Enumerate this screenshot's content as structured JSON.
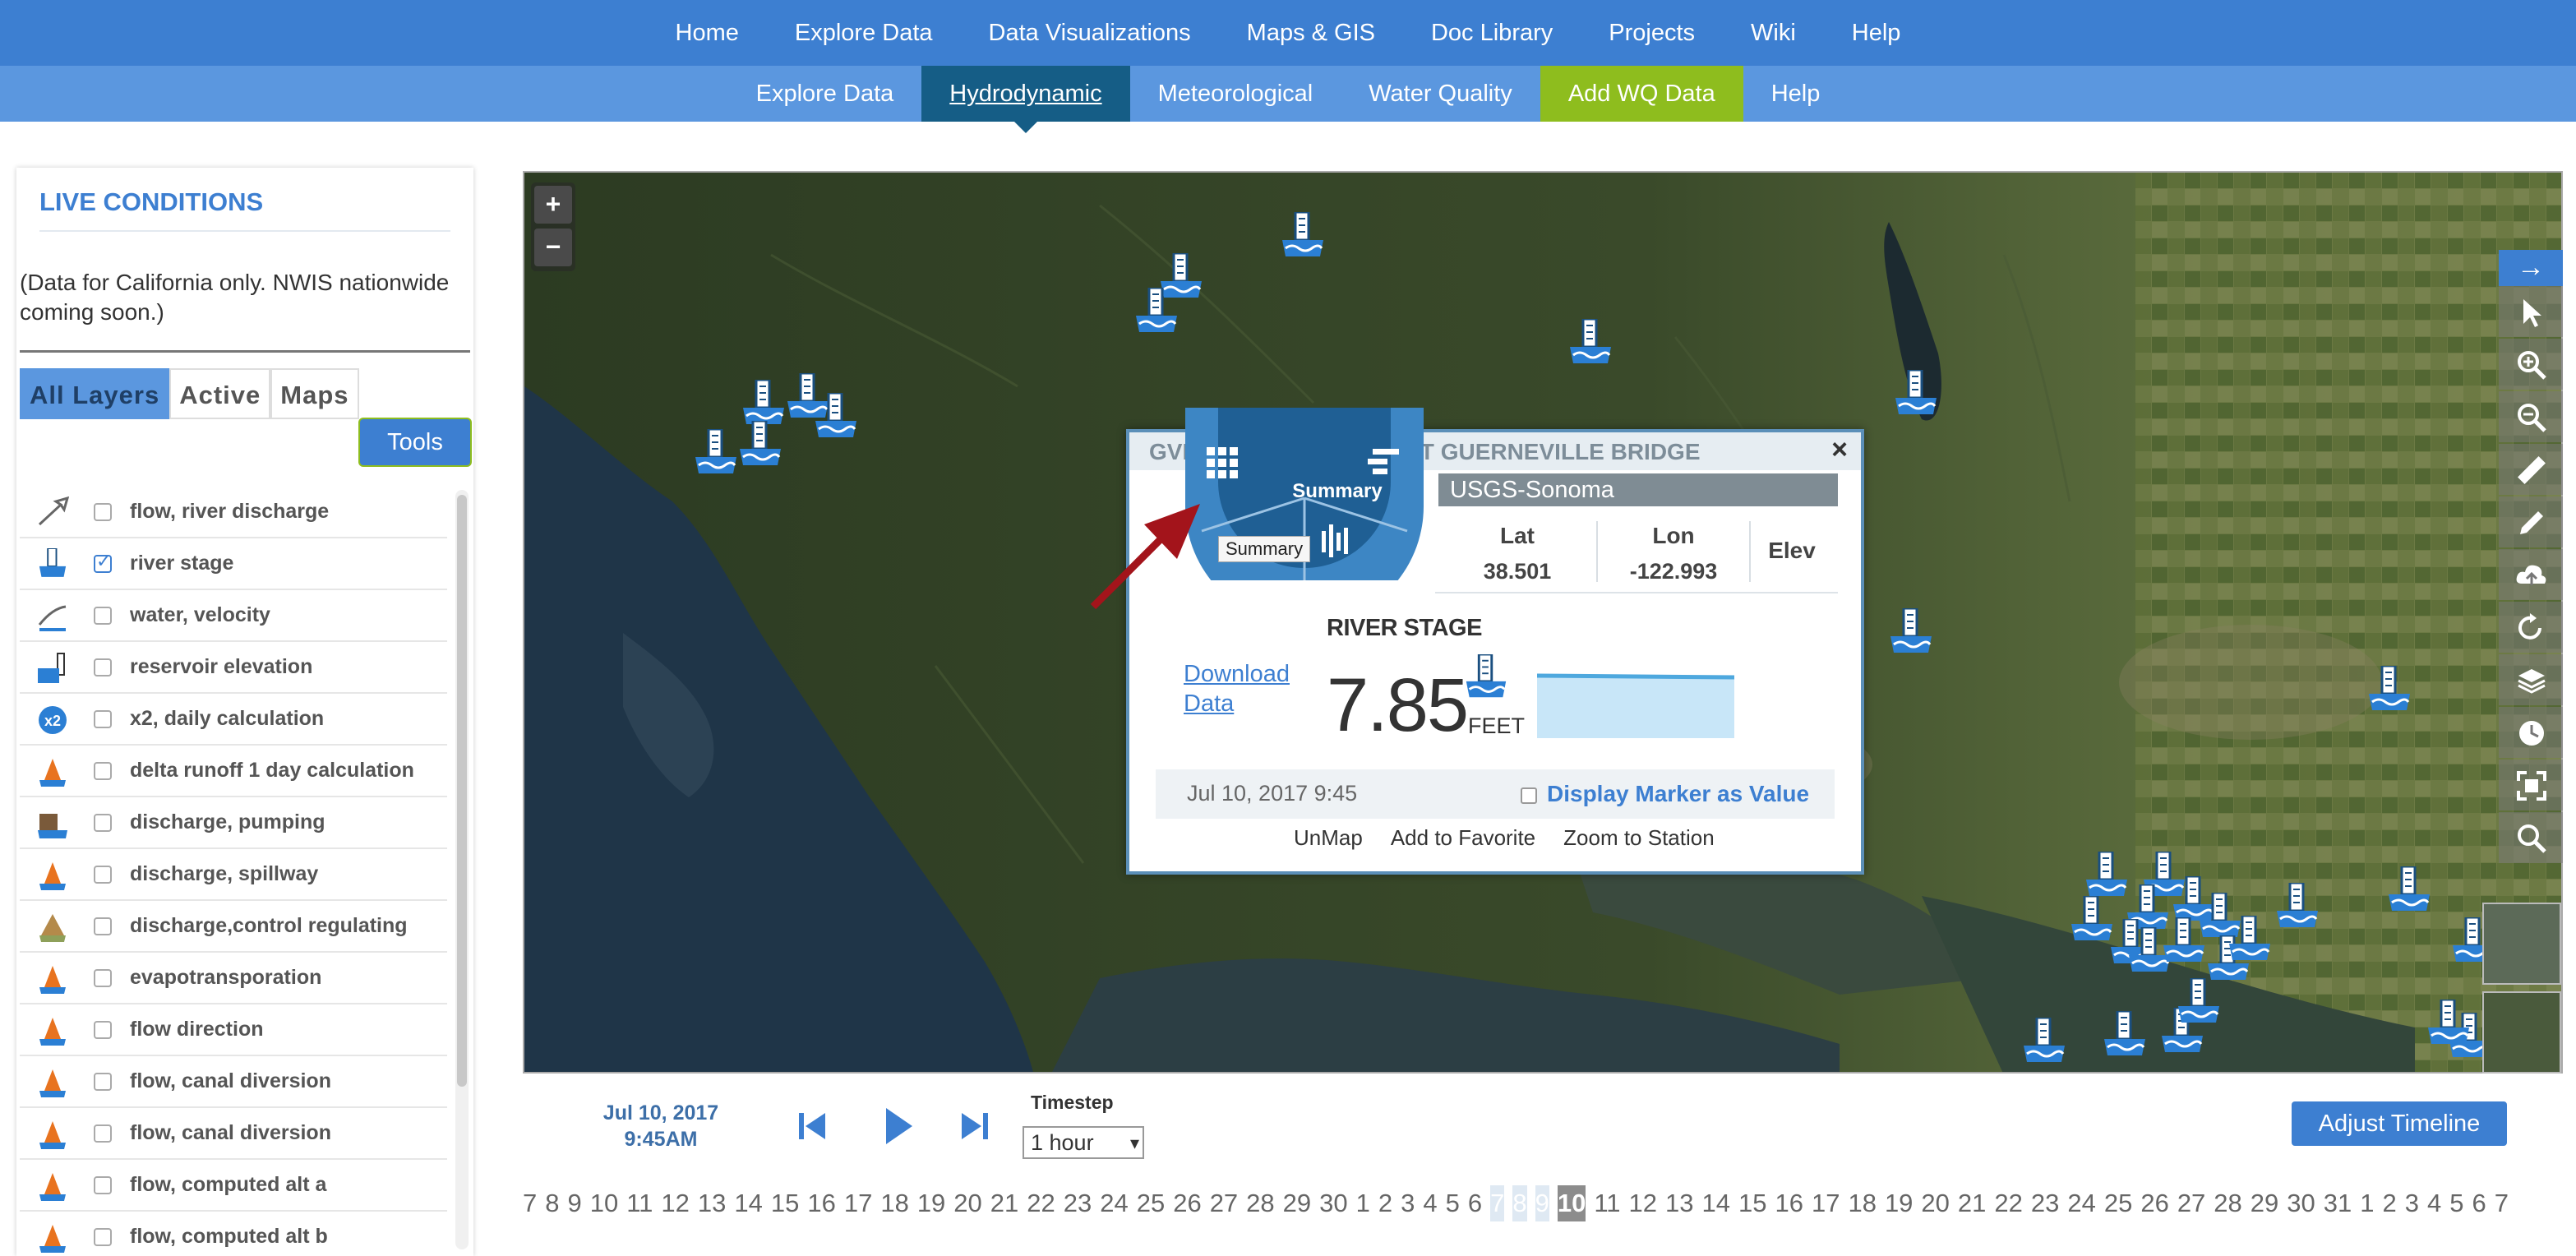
{
  "topnav": [
    "Home",
    "Explore Data",
    "Data Visualizations",
    "Maps & GIS",
    "Doc Library",
    "Projects",
    "Wiki",
    "Help"
  ],
  "subnav": [
    {
      "label": "Explore Data",
      "style": "normal"
    },
    {
      "label": "Hydrodynamic",
      "style": "active"
    },
    {
      "label": "Meteorological",
      "style": "normal"
    },
    {
      "label": "Water Quality",
      "style": "normal"
    },
    {
      "label": "Add WQ Data",
      "style": "green"
    },
    {
      "label": "Help",
      "style": "normal"
    }
  ],
  "panel": {
    "title": "LIVE CONDITIONS",
    "note": "(Data for California only. NWIS nationwide coming soon.)",
    "tabs": [
      "All Layers",
      "Active",
      "Maps"
    ],
    "tools_label": "Tools",
    "layers": [
      {
        "label": "flow, river discharge",
        "checked": false,
        "icon": "arrow-icon"
      },
      {
        "label": "river stage",
        "checked": true,
        "icon": "gauge-icon"
      },
      {
        "label": "water, velocity",
        "checked": false,
        "icon": "velocity-icon"
      },
      {
        "label": "reservoir elevation",
        "checked": false,
        "icon": "reservoir-icon"
      },
      {
        "label": "x2, daily calculation",
        "checked": false,
        "icon": "x2-icon"
      },
      {
        "label": "delta runoff 1 day calculation",
        "checked": false,
        "icon": "cone-icon"
      },
      {
        "label": "discharge, pumping",
        "checked": false,
        "icon": "pump-icon"
      },
      {
        "label": "discharge, spillway",
        "checked": false,
        "icon": "cone-icon"
      },
      {
        "label": "discharge,control regulating",
        "checked": false,
        "icon": "control-icon"
      },
      {
        "label": "evapotransporation",
        "checked": false,
        "icon": "cone-icon"
      },
      {
        "label": "flow direction",
        "checked": false,
        "icon": "cone-icon"
      },
      {
        "label": "flow, canal diversion",
        "checked": false,
        "icon": "cone-icon"
      },
      {
        "label": "flow, canal diversion",
        "checked": false,
        "icon": "cone-icon"
      },
      {
        "label": "flow, computed alt a",
        "checked": false,
        "icon": "cone-icon"
      },
      {
        "label": "flow, computed alt b",
        "checked": false,
        "icon": "cone-icon"
      }
    ]
  },
  "map": {
    "zoom_in": "+",
    "zoom_out": "−"
  },
  "popup": {
    "title": "GVB - RUSSIAN RIVER AT GUERNEVILLE BRIDGE",
    "close": "×",
    "owner": "USGS-Sonoma",
    "wheel_label": "Summary",
    "tooltip": "Summary",
    "lat_label": "Lat",
    "lat": "38.501",
    "lon_label": "Lon",
    "lon": "-122.993",
    "elev_label": "Elev",
    "measure_label": "RIVER STAGE",
    "download": "Download Data",
    "value": "7.85",
    "unit": "FEET",
    "timestamp": "Jul 10, 2017 9:45",
    "display_marker": "Display Marker as Value",
    "actions": [
      "UnMap",
      "Add to Favorite",
      "Zoom to Station"
    ]
  },
  "timeline": {
    "date_line1": "Jul 10, 2017",
    "date_line2": "9:45AM",
    "timestep_label": "Timestep",
    "timestep_value": "1 hour",
    "adjust_label": "Adjust Timeline",
    "days": [
      "7",
      "8",
      "9",
      "10",
      "11",
      "12",
      "13",
      "14",
      "15",
      "16",
      "17",
      "18",
      "19",
      "20",
      "21",
      "22",
      "23",
      "24",
      "25",
      "26",
      "27",
      "28",
      "29",
      "30",
      "1",
      "2",
      "3",
      "4",
      "5",
      "6",
      "7",
      "8",
      "9",
      "10",
      "11",
      "12",
      "13",
      "14",
      "15",
      "16",
      "17",
      "18",
      "19",
      "20",
      "21",
      "22",
      "23",
      "24",
      "25",
      "26",
      "27",
      "28",
      "29",
      "30",
      "31",
      "1",
      "2",
      "3",
      "4",
      "5",
      "6",
      "7"
    ],
    "selected_days": [
      30,
      31,
      32
    ],
    "current_day": 33
  },
  "colors": {
    "nav_blue": "#3d7fd1",
    "active_tab": "#155d86",
    "green": "#8ebd1e",
    "station_blue": "#2b7fd4"
  }
}
